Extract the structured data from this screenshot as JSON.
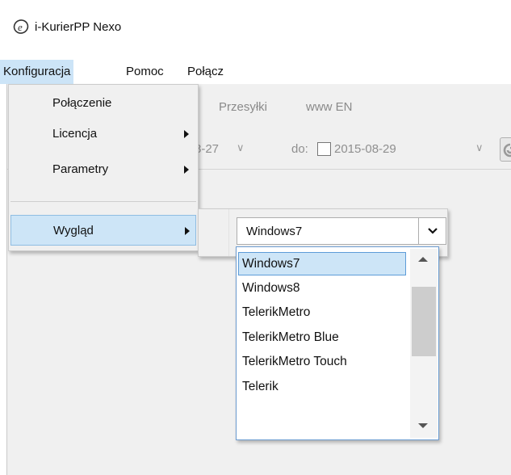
{
  "app": {
    "title": "i-KurierPP Nexo",
    "accent": "#cce4f7"
  },
  "menubar": {
    "items": [
      {
        "label": "Konfiguracja"
      },
      {
        "label": "Pomoc"
      },
      {
        "label": "Połącz"
      }
    ]
  },
  "tabs": [
    {
      "label": "Przesyłki"
    },
    {
      "label": "www EN"
    }
  ],
  "filter": {
    "date_from_partial": "8-27",
    "to_label": "do:",
    "date_to": "2015-08-29",
    "dropdown_glyph": "∨"
  },
  "config_menu": {
    "items": [
      {
        "label": "Połączenie",
        "has_submenu": false
      },
      {
        "label": "Licencja",
        "has_submenu": true
      },
      {
        "label": "Parametry",
        "has_submenu": true
      },
      {
        "label": "Wygląd",
        "has_submenu": true
      }
    ]
  },
  "theme": {
    "selected": "Windows7",
    "options": [
      "Windows7",
      "Windows8",
      "TelerikMetro",
      "TelerikMetro Blue",
      "TelerikMetro Touch",
      "Telerik"
    ]
  }
}
